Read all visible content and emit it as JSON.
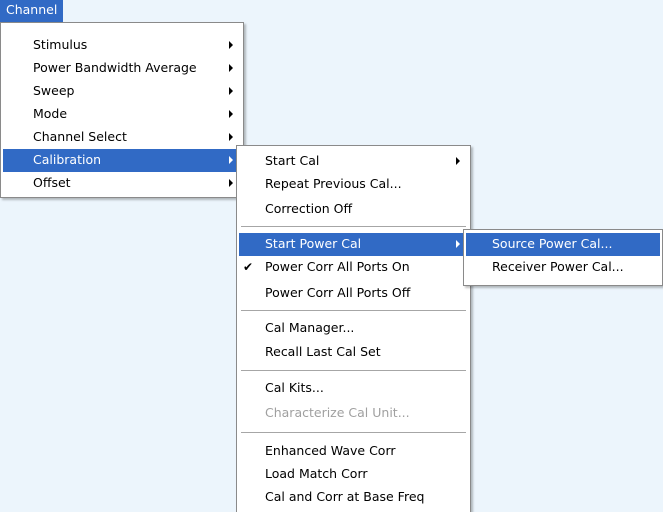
{
  "menubar": {
    "channel_label": "Channel"
  },
  "channel_menu": {
    "items": [
      {
        "label": "Stimulus"
      },
      {
        "label": "Power Bandwidth Average"
      },
      {
        "label": "Sweep"
      },
      {
        "label": "Mode"
      },
      {
        "label": "Channel Select"
      },
      {
        "label": "Calibration"
      },
      {
        "label": "Offset"
      }
    ]
  },
  "calibration_menu": {
    "start_cal": "Start Cal",
    "repeat_previous_cal": "Repeat Previous Cal...",
    "correction_off": "Correction Off",
    "start_power_cal": "Start Power Cal",
    "power_corr_all_on": "Power Corr All Ports On",
    "power_corr_all_off": "Power Corr All Ports Off",
    "cal_manager": "Cal Manager...",
    "recall_last_cal_set": "Recall Last Cal Set",
    "cal_kits": "Cal Kits...",
    "characterize_cal_unit": "Characterize Cal Unit...",
    "enhanced_wave_corr": "Enhanced Wave Corr",
    "load_match_corr": "Load Match Corr",
    "cal_and_corr_base_freq": "Cal and Corr at Base Freq",
    "check_mark": "✔"
  },
  "power_cal_menu": {
    "source_power_cal": "Source Power Cal...",
    "receiver_power_cal": "Receiver Power Cal..."
  },
  "colors": {
    "highlight": "#316ac5",
    "background": "#ecf5fc"
  }
}
